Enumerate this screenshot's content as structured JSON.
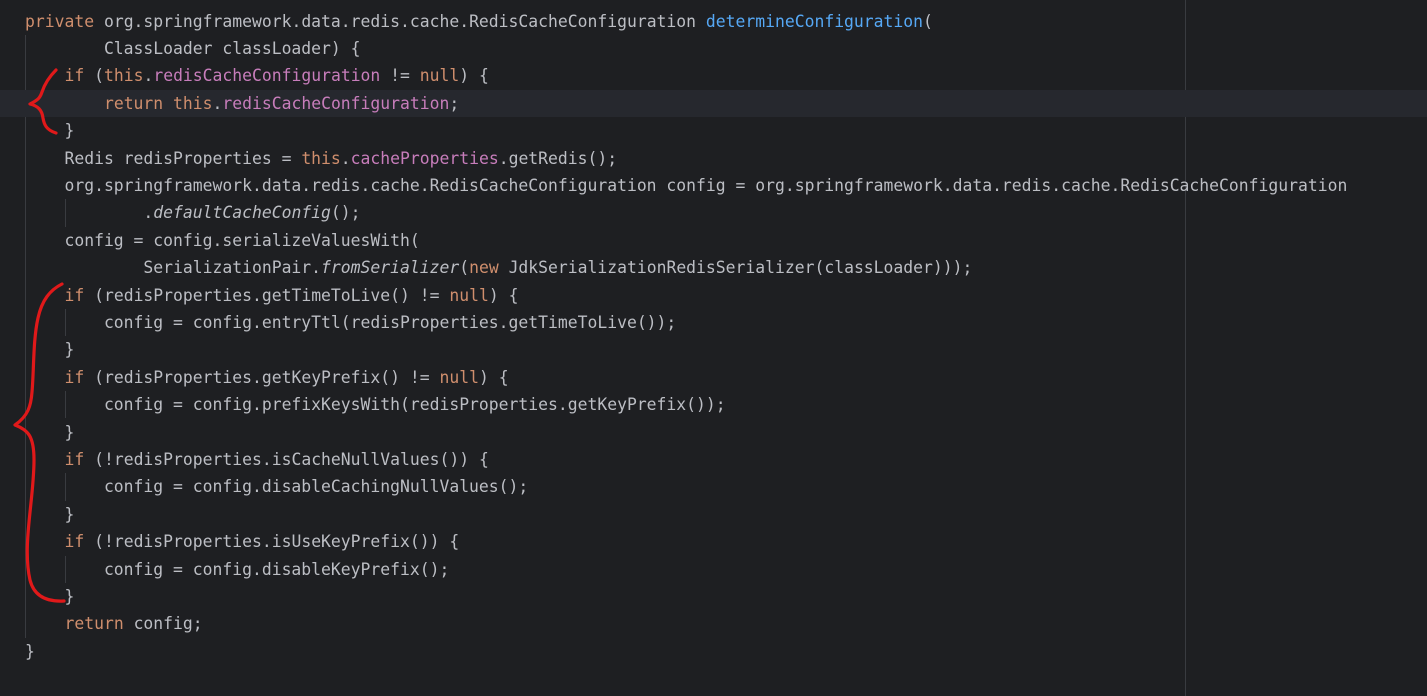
{
  "editor": {
    "lines": [
      [
        {
          "t": "private ",
          "c": "kw"
        },
        {
          "t": "org.springframework.data.redis.cache.RedisCacheConfiguration "
        },
        {
          "t": "determineConfiguration",
          "c": "decl"
        },
        {
          "t": "("
        }
      ],
      [
        {
          "t": "        ClassLoader classLoader) {"
        }
      ],
      [
        {
          "t": "    "
        },
        {
          "t": "if ",
          "c": "kw"
        },
        {
          "t": "("
        },
        {
          "t": "this",
          "c": "kw"
        },
        {
          "t": "."
        },
        {
          "t": "redisCacheConfiguration",
          "c": "field"
        },
        {
          "t": " != "
        },
        {
          "t": "null",
          "c": "kw"
        },
        {
          "t": ") {"
        }
      ],
      [
        {
          "t": "        "
        },
        {
          "t": "return ",
          "c": "kw"
        },
        {
          "t": "this",
          "c": "kw"
        },
        {
          "t": "."
        },
        {
          "t": "redisCacheConfiguration",
          "c": "field"
        },
        {
          "t": ";"
        }
      ],
      [
        {
          "t": "    }"
        }
      ],
      [
        {
          "t": "    Redis redisProperties = "
        },
        {
          "t": "this",
          "c": "kw"
        },
        {
          "t": "."
        },
        {
          "t": "cacheProperties",
          "c": "field"
        },
        {
          "t": ".getRedis();"
        }
      ],
      [
        {
          "t": "    org.springframework.data.redis.cache.RedisCacheConfiguration config = org.springframework.data.redis.cache.RedisCacheConfiguration"
        }
      ],
      [
        {
          "t": "            ."
        },
        {
          "t": "defaultCacheConfig",
          "c": "it"
        },
        {
          "t": "();"
        }
      ],
      [
        {
          "t": "    config = config.serializeValuesWith("
        }
      ],
      [
        {
          "t": "            SerializationPair."
        },
        {
          "t": "fromSerializer",
          "c": "it"
        },
        {
          "t": "("
        },
        {
          "t": "new ",
          "c": "kw"
        },
        {
          "t": "JdkSerializationRedisSerializer(classLoader)));"
        }
      ],
      [
        {
          "t": "    "
        },
        {
          "t": "if ",
          "c": "kw"
        },
        {
          "t": "(redisProperties.getTimeToLive() != "
        },
        {
          "t": "null",
          "c": "kw"
        },
        {
          "t": ") {"
        }
      ],
      [
        {
          "t": "        config = config.entryTtl(redisProperties.getTimeToLive());"
        }
      ],
      [
        {
          "t": "    }"
        }
      ],
      [
        {
          "t": "    "
        },
        {
          "t": "if ",
          "c": "kw"
        },
        {
          "t": "(redisProperties.getKeyPrefix() != "
        },
        {
          "t": "null",
          "c": "kw"
        },
        {
          "t": ") {"
        }
      ],
      [
        {
          "t": "        config = config.prefixKeysWith(redisProperties.getKeyPrefix());"
        }
      ],
      [
        {
          "t": "    }"
        }
      ],
      [
        {
          "t": "    "
        },
        {
          "t": "if ",
          "c": "kw"
        },
        {
          "t": "(!redisProperties.isCacheNullValues()) {"
        }
      ],
      [
        {
          "t": "        config = config.disableCachingNullValues();"
        }
      ],
      [
        {
          "t": "    }"
        }
      ],
      [
        {
          "t": "    "
        },
        {
          "t": "if ",
          "c": "kw"
        },
        {
          "t": "(!redisProperties.isUseKeyPrefix()) {"
        }
      ],
      [
        {
          "t": "        config = config.disableKeyPrefix();"
        }
      ],
      [
        {
          "t": "    }"
        }
      ],
      [
        {
          "t": "    "
        },
        {
          "t": "return ",
          "c": "kw"
        },
        {
          "t": "config;"
        }
      ],
      [
        {
          "t": "}"
        }
      ]
    ],
    "current_line": 3
  },
  "colors": {
    "background": "#1e1f22",
    "keyword": "#cf8e6d",
    "field": "#c77dbb",
    "declaration": "#56a8f5",
    "text": "#bcbec4",
    "annotation": "#e0191a"
  }
}
